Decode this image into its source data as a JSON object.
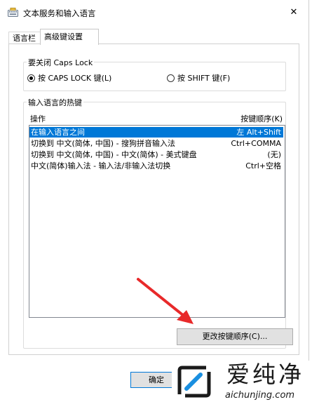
{
  "window": {
    "title": "文本服务和输入语言",
    "close_glyph": "✕"
  },
  "tabs": [
    {
      "label": "语言栏"
    },
    {
      "label": "高级键设置"
    }
  ],
  "caps_lock_group": {
    "legend": "要关闭 Caps Lock",
    "options": [
      {
        "label": "按 CAPS LOCK 键(L)",
        "checked": true
      },
      {
        "label": "按 SHIFT 键(F)",
        "checked": false
      }
    ]
  },
  "hotkeys_group": {
    "legend": "输入语言的热键",
    "col_action": "操作",
    "col_keys": "按键顺序(K)",
    "rows": [
      {
        "action": "在输入语言之间",
        "keys": "左 Alt+Shift"
      },
      {
        "action": "切换到 中文(简体, 中国) - 搜狗拼音输入法",
        "keys": "Ctrl+COMMA"
      },
      {
        "action": "切换到 中文(简体, 中国) - 中文(简体) - 美式键盘",
        "keys": "(无)"
      },
      {
        "action": "中文(简体)输入法 - 输入法/非输入法切换",
        "keys": "Ctrl+空格"
      }
    ],
    "change_button": "更改按键顺序(C)..."
  },
  "footer": {
    "ok_button": "确定"
  },
  "watermark": {
    "title": "爱纯净",
    "url": "aichunjing.com"
  },
  "colors": {
    "selection": "#0078d7",
    "arrow": "#e8292a",
    "watermark_accent": "#1a8fe0"
  }
}
